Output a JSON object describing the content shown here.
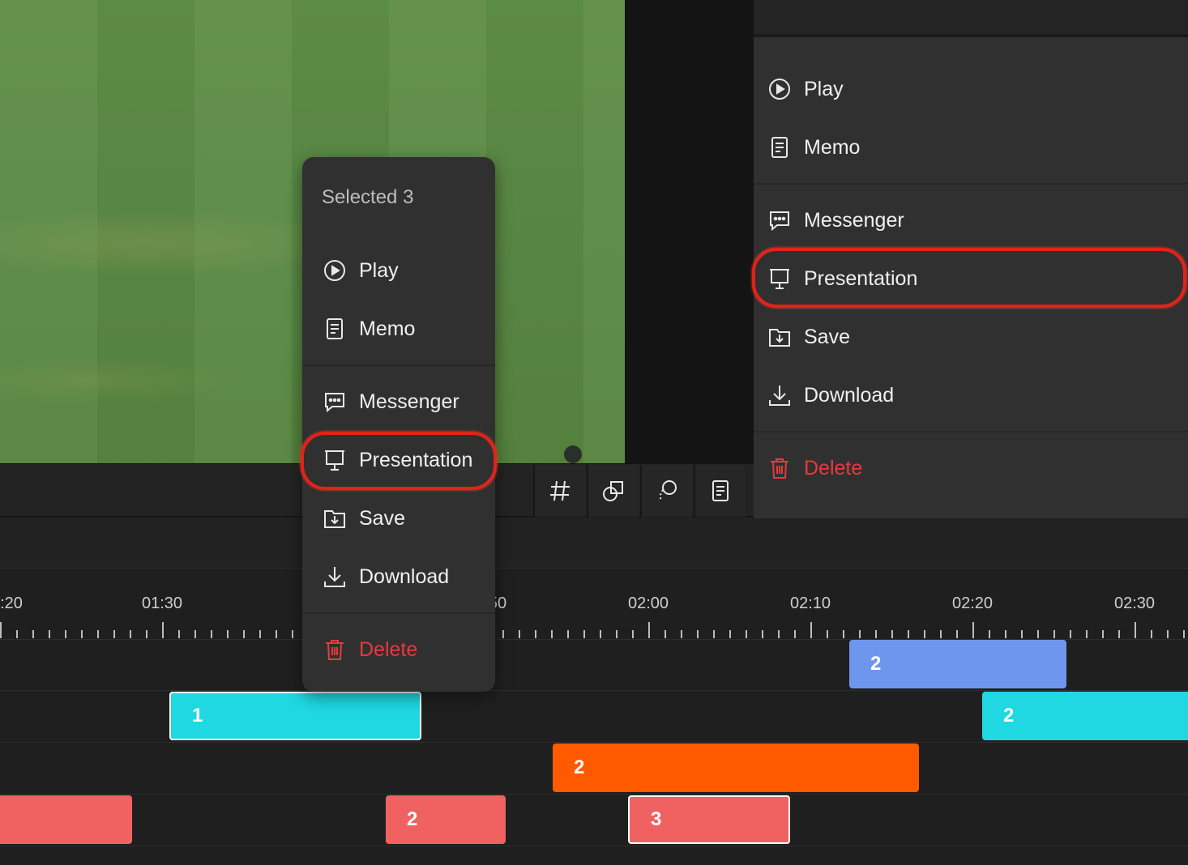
{
  "popup": {
    "title": "Selected 3",
    "items": [
      {
        "label": "Play",
        "icon": "play-circle-icon"
      },
      {
        "label": "Memo",
        "icon": "memo-icon"
      },
      {
        "label": "Messenger",
        "icon": "messenger-icon"
      },
      {
        "label": "Presentation",
        "icon": "presentation-icon"
      },
      {
        "label": "Save",
        "icon": "save-icon"
      },
      {
        "label": "Download",
        "icon": "download-icon"
      },
      {
        "label": "Delete",
        "icon": "trash-icon"
      }
    ]
  },
  "side_menu": {
    "items": [
      {
        "label": "Play",
        "icon": "play-circle-icon"
      },
      {
        "label": "Memo",
        "icon": "memo-icon"
      },
      {
        "label": "Messenger",
        "icon": "messenger-icon"
      },
      {
        "label": "Presentation",
        "icon": "presentation-icon"
      },
      {
        "label": "Save",
        "icon": "save-icon"
      },
      {
        "label": "Download",
        "icon": "download-icon"
      },
      {
        "label": "Delete",
        "icon": "trash-icon"
      }
    ]
  },
  "toolbar": {
    "buttons": [
      "hashtag-icon",
      "shapes-icon",
      "lasso-icon",
      "memo-icon"
    ]
  },
  "timeline": {
    "tick_labels": [
      ":20",
      "01:30",
      "50",
      "02:00",
      "02:10",
      "02:20",
      "02:30"
    ],
    "clips": [
      {
        "label": "2",
        "color": "#6f96ee"
      },
      {
        "label": "1",
        "color": "#1fd8e2"
      },
      {
        "label": "2",
        "color": "#1fd8e2"
      },
      {
        "label": "2",
        "color": "#ff5a00"
      },
      {
        "label": "",
        "color": "#f06262"
      },
      {
        "label": "2",
        "color": "#f06262"
      },
      {
        "label": "3",
        "color": "#f06262"
      }
    ]
  },
  "colors": {
    "danger": "#e83a3a",
    "highlight": "#e2231a"
  }
}
